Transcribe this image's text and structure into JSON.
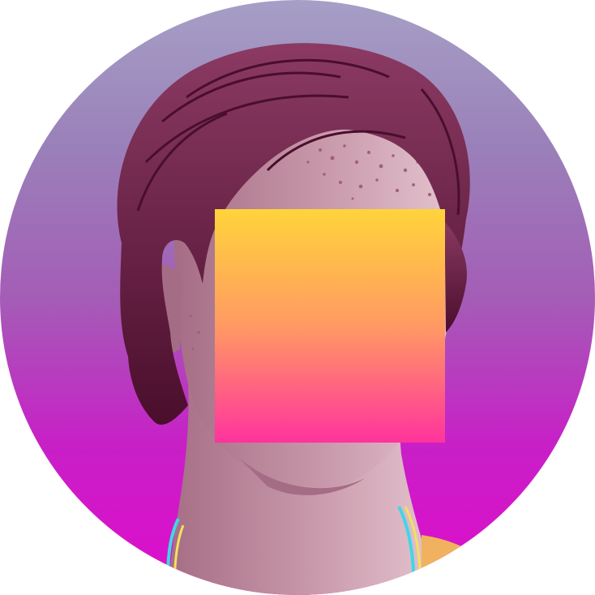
{
  "avatar": {
    "background_gradient": [
      "#a69fc6",
      "#9a80b9",
      "#a45db6",
      "#c81fc7",
      "#e00ccc"
    ],
    "tone": {
      "hair": "#6e1f45",
      "hair_dark": "#4a0e2c",
      "hair_light": "#8b3a63",
      "skin": "#c99aab",
      "skin_shadow": "#a56d85",
      "skin_light": "#e4c3cf",
      "freckle": "#a25f7a"
    },
    "necklace_colors": [
      "#3fd7e6",
      "#f4e15a"
    ],
    "shoulder_color": "#f0b25e"
  },
  "overlay": {
    "gradient_top": "#ffd43a",
    "gradient_mid": "#ff9a63",
    "gradient_bottom": "#ff339d",
    "icon": "censor-square"
  }
}
